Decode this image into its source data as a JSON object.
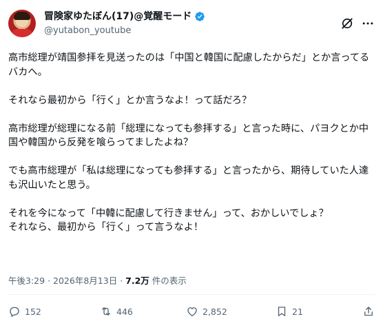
{
  "author": {
    "display_name": "冒険家ゆたぼん(17)@覚醒モード",
    "handle": "@yutabon_youtube",
    "verified_color": "#1d9bf0"
  },
  "tweet": {
    "text": "高市総理が靖国参拝を見送ったのは「中国と韓国に配慮したからだ」とか言ってるバカへ。\n\nそれなら最初から「行く」とか言うなよ！って話だろ？\n\n高市総理が総理になる前「総理になっても参拝する」と言った時に、パヨクとか中国や韓国から反発を喰らってましたよね？\n\nでも高市総理が「私は総理になっても参拝する」と言ったから、期待していた人達も沢山いたと思う。\n\nそれを今になって「中韓に配慮して行きません」って、おかしいでしょ？\nそれなら、最初から「行く」って言うなよ！",
    "time": "午後3:29",
    "separator": "·",
    "date": "2026年8月13日",
    "views_count": "7.2万",
    "views_label": "件の表示"
  },
  "actions": {
    "replies": "152",
    "reposts": "446",
    "likes": "2,852",
    "bookmarks": "21"
  },
  "icons": [
    "grok-icon",
    "more-icon",
    "reply-icon",
    "repost-icon",
    "like-icon",
    "bookmark-icon",
    "share-icon"
  ]
}
